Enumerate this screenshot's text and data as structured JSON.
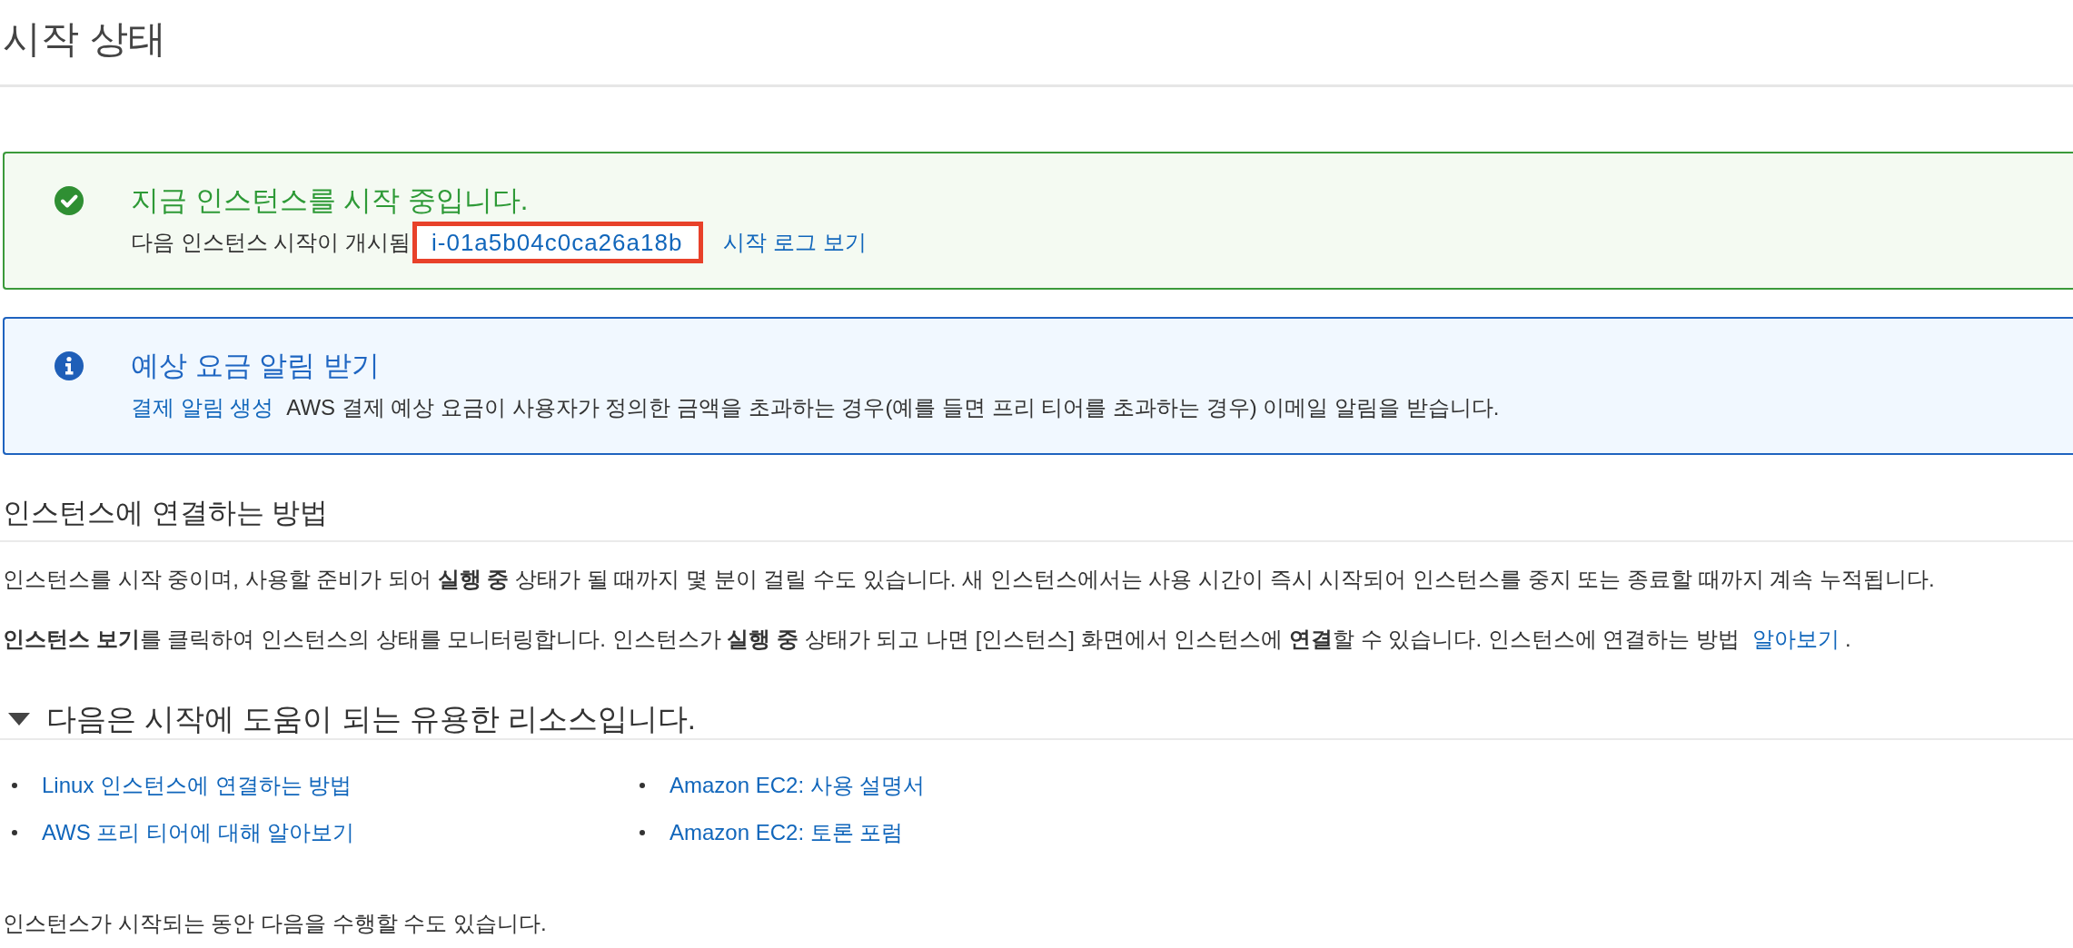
{
  "page": {
    "title": "시작 상태"
  },
  "alerts": [
    {
      "kind": "success",
      "title": "지금 인스턴스를 시작 중입니다.",
      "parts": [
        {
          "kind": "text",
          "text": "다음 인스턴스 시작이 개시됨"
        },
        {
          "kind": "link",
          "text": "i-01a5b04c0ca26a18b",
          "highlighted": true
        },
        {
          "kind": "link",
          "text": "시작 로그 보기",
          "highlighted": false
        }
      ]
    },
    {
      "kind": "info",
      "title": "예상 요금 알림 받기",
      "parts": [
        {
          "kind": "link",
          "text": "결제 알림 생성",
          "highlighted": false
        },
        {
          "kind": "text",
          "text": "AWS 결제 예상 요금이 사용자가 정의한 금액을 초과하는 경우(예를 들면 프리 티어를 초과하는 경우) 이메일 알림을 받습니다."
        }
      ]
    }
  ],
  "connect_section": {
    "heading": "인스턴스에 연결하는 방법",
    "paragraphs": [
      {
        "parts": [
          {
            "kind": "text",
            "text": "인스턴스를 시작 중이며, 사용할 준비가 되어 **실행 중** 상태가 될 때까지 몇 분이 걸릴 수도 있습니다. 새 인스턴스에서는 사용 시간이 즉시 시작되어 인스턴스를 중지 또는 종료할 때까지 계속 누적됩니다."
          }
        ]
      },
      {
        "parts": [
          {
            "kind": "text",
            "text": "**인스턴스 보기**를 클릭하여 인스턴스의 상태를 모니터링합니다. 인스턴스가 **실행 중** 상태가 되고 나면 [인스턴스] 화면에서 인스턴스에 **연결**할 수 있습니다. 인스턴스에 연결하는 방법"
          },
          {
            "kind": "link",
            "text": "알아보기"
          },
          {
            "kind": "text",
            "text": "."
          }
        ]
      }
    ]
  },
  "resources_section": {
    "heading": "다음은 시작에 도움이 되는 유용한 리소스입니다.",
    "expanded": true,
    "columns": [
      {
        "links": [
          "Linux 인스턴스에 연결하는 방법",
          "AWS 프리 티어에 대해 알아보기"
        ]
      },
      {
        "links": [
          "Amazon EC2: 사용 설명서",
          "Amazon EC2: 토론 포럼"
        ]
      }
    ]
  },
  "closing_text": "인스턴스가 시작되는 동안 다음을 수행할 수도 있습니다."
}
